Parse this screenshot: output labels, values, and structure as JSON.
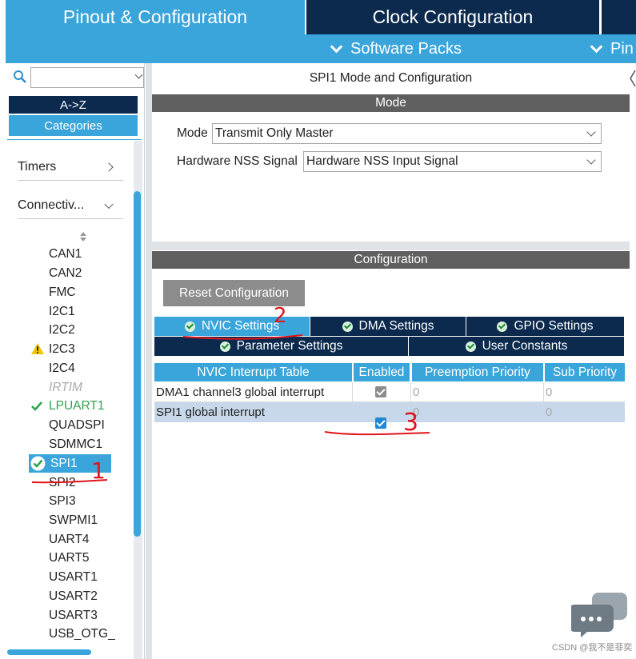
{
  "top_tabs": {
    "pinout": "Pinout & Configuration",
    "clock": "Clock Configuration"
  },
  "subbar": {
    "software_packs": "Software Packs",
    "pinout_partial": "Pin"
  },
  "left": {
    "search_value": "",
    "sort_az": "A->Z",
    "categories": "Categories",
    "cat_timers": "Timers",
    "cat_connectivity": "Connectiv...",
    "peripherals": [
      "CAN1",
      "CAN2",
      "FMC",
      "I2C1",
      "I2C2",
      "I2C3",
      "I2C4",
      "IRTIM",
      "LPUART1",
      "QUADSPI",
      "SDMMC1",
      "SPI1",
      "SPI2",
      "SPI3",
      "SWPMI1",
      "UART4",
      "UART5",
      "USART1",
      "USART2",
      "USART3",
      "USB_OTG_"
    ],
    "selected": "SPI1"
  },
  "mode_panel": {
    "title": "SPI1 Mode and Configuration",
    "header": "Mode",
    "mode_label": "Mode",
    "mode_value": "Transmit Only Master",
    "nss_label": "Hardware NSS Signal",
    "nss_value": "Hardware NSS Input Signal"
  },
  "config_panel": {
    "header": "Configuration",
    "reset_button": "Reset Configuration",
    "tabs": {
      "nvic": "NVIC Settings",
      "dma": "DMA Settings",
      "gpio": "GPIO Settings",
      "parameter": "Parameter Settings",
      "user": "User Constants"
    },
    "table": {
      "columns": [
        "NVIC Interrupt Table",
        "Enabled",
        "Preemption Priority",
        "Sub Priority"
      ],
      "rows": [
        {
          "name": "DMA1 channel3 global interrupt",
          "enabled": true,
          "preemption": "0",
          "sub": "0"
        },
        {
          "name": "SPI1 global interrupt",
          "enabled": true,
          "preemption": "0",
          "sub": "0"
        }
      ]
    }
  },
  "annotations": {
    "mark1": "1",
    "mark2": "2",
    "mark3": "3"
  },
  "watermark": "CSDN @我不是菲奕",
  "colors": {
    "accent": "#3aa5db",
    "navy": "#0b2a4e",
    "annotation": "#e0141b",
    "ok_green": "#1c8a3b",
    "warning": "#f5c400"
  }
}
